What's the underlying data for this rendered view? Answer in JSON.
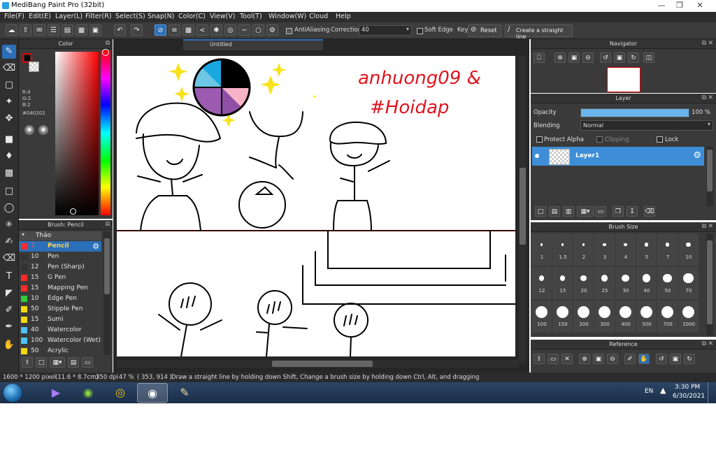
{
  "window": {
    "title": "MediBang Paint Pro (32bit)"
  },
  "menu": [
    "File(F)",
    "Edit(E)",
    "Layer(L)",
    "Filter(R)",
    "Select(S)",
    "Snap(N)",
    "Color(C)",
    "View(V)",
    "Tool(T)",
    "Window(W)",
    "Cloud",
    "Help"
  ],
  "toolbar": {
    "antialiasing_label": "AntiAliasing",
    "correction_label": "Correction",
    "correction_value": "40",
    "soft_edge_label": "Soft Edge",
    "key_label": "Key",
    "reset_label": "Reset",
    "straight_line_label": "Create a straight line"
  },
  "color_panel": {
    "title": "Color",
    "r": "R:4",
    "g": "G:2",
    "b": "B:2",
    "hex": "#040202",
    "primary_color": "#040202"
  },
  "brush_panel": {
    "title": "Brush: Pencil",
    "group": "Thảo",
    "items": [
      {
        "color": "#ff2a2a",
        "size": "7",
        "name": "Pencil"
      },
      {
        "color": "#333333",
        "size": "10",
        "name": "Pen"
      },
      {
        "color": "#333333",
        "size": "12",
        "name": "Pen (Sharp)"
      },
      {
        "color": "#ff2a2a",
        "size": "15",
        "name": "G Pen"
      },
      {
        "color": "#ff2a2a",
        "size": "15",
        "name": "Mapping Pen"
      },
      {
        "color": "#2ecc40",
        "size": "10",
        "name": "Edge Pen"
      },
      {
        "color": "#f5d90a",
        "size": "50",
        "name": "Stipple Pen"
      },
      {
        "color": "#f5d90a",
        "size": "15",
        "name": "Sumi"
      },
      {
        "color": "#4fc3f7",
        "size": "40",
        "name": "Watercolor"
      },
      {
        "color": "#4fc3f7",
        "size": "100",
        "name": "Watercolor (Wet)"
      },
      {
        "color": "#f5d90a",
        "size": "50",
        "name": "Acrylic"
      }
    ]
  },
  "canvas": {
    "tab_title": "Untitled",
    "signature": "anhuong09 &",
    "hashtag": "#Hoidap"
  },
  "navigator": {
    "title": "Navigator"
  },
  "layer_panel": {
    "title": "Layer",
    "opacity_label": "Opacity",
    "opacity_value": "100 %",
    "opacity_fraction": 1.0,
    "blending_label": "Blending",
    "blending_value": "Normal",
    "protect_alpha_label": "Protect Alpha",
    "clipping_label": "Clipping",
    "lock_label": "Lock",
    "layer_name": "Layer1"
  },
  "brush_size": {
    "title": "Brush Size",
    "sizes": [
      "1",
      "1.5",
      "2",
      "3",
      "4",
      "5",
      "7",
      "10",
      "12",
      "15",
      "20",
      "25",
      "30",
      "40",
      "50",
      "70",
      "100",
      "150",
      "200",
      "300",
      "400",
      "500",
      "700",
      "1000"
    ]
  },
  "reference": {
    "title": "Reference"
  },
  "status": {
    "dimensions": "1600 * 1200 pixel",
    "physical": "(11.6 * 8.7cm)",
    "dpi": "350 dpi",
    "zoom": "47 %",
    "coords": "( 353, 914 )",
    "hint": "Draw a straight line by holding down Shift, Change a brush size by holding down Ctrl, Alt, and dragging"
  },
  "taskbar": {
    "language": "EN",
    "time": "3:30 PM",
    "date": "6/30/2021"
  }
}
